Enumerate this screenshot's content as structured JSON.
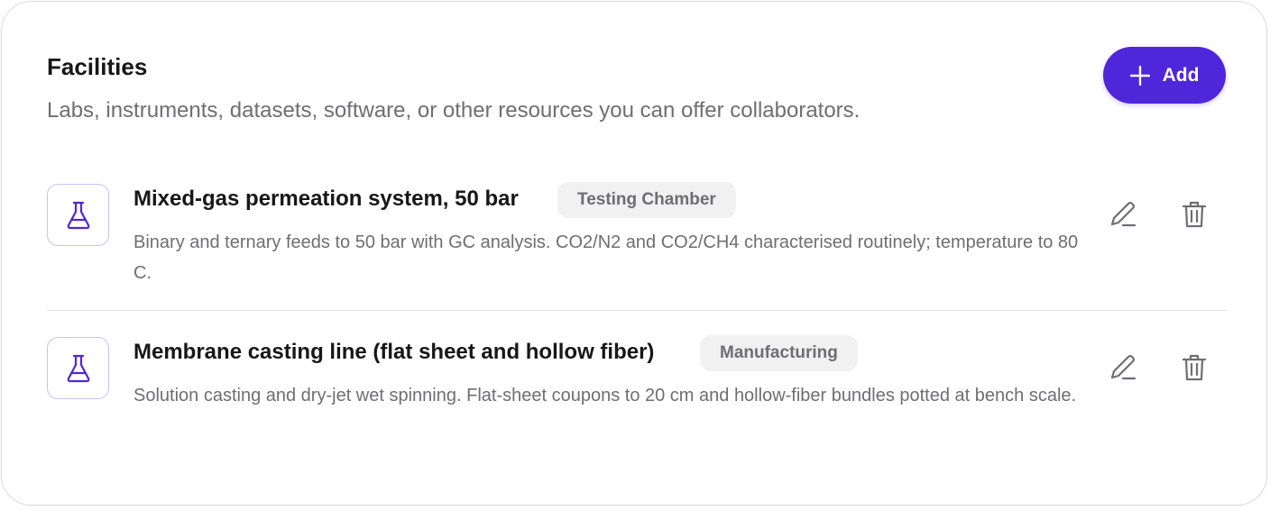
{
  "section": {
    "title": "Facilities",
    "subtitle": "Labs, instruments, datasets, software, or other resources you can offer collaborators.",
    "add_label": "Add"
  },
  "colors": {
    "accent": "#4f26d9",
    "badge_bg": "#f1f1f1",
    "muted_text": "#6e6e73"
  },
  "facilities": [
    {
      "title": "Mixed-gas permeation system, 50 bar",
      "badge": "Testing Chamber",
      "description": "Binary and ternary feeds to 50 bar with GC analysis. CO2/N2 and CO2/CH4 characterised routinely; temperature to 80 C.",
      "icon": "flask-icon"
    },
    {
      "title": "Membrane casting line (flat sheet and hollow fiber)",
      "badge": "Manufacturing",
      "description": "Solution casting and dry-jet wet spinning. Flat-sheet coupons to 20 cm and hollow-fiber bundles potted at bench scale.",
      "icon": "flask-icon"
    }
  ],
  "icons": {
    "edit": "pencil-icon",
    "delete": "trash-icon",
    "add": "plus-icon"
  }
}
